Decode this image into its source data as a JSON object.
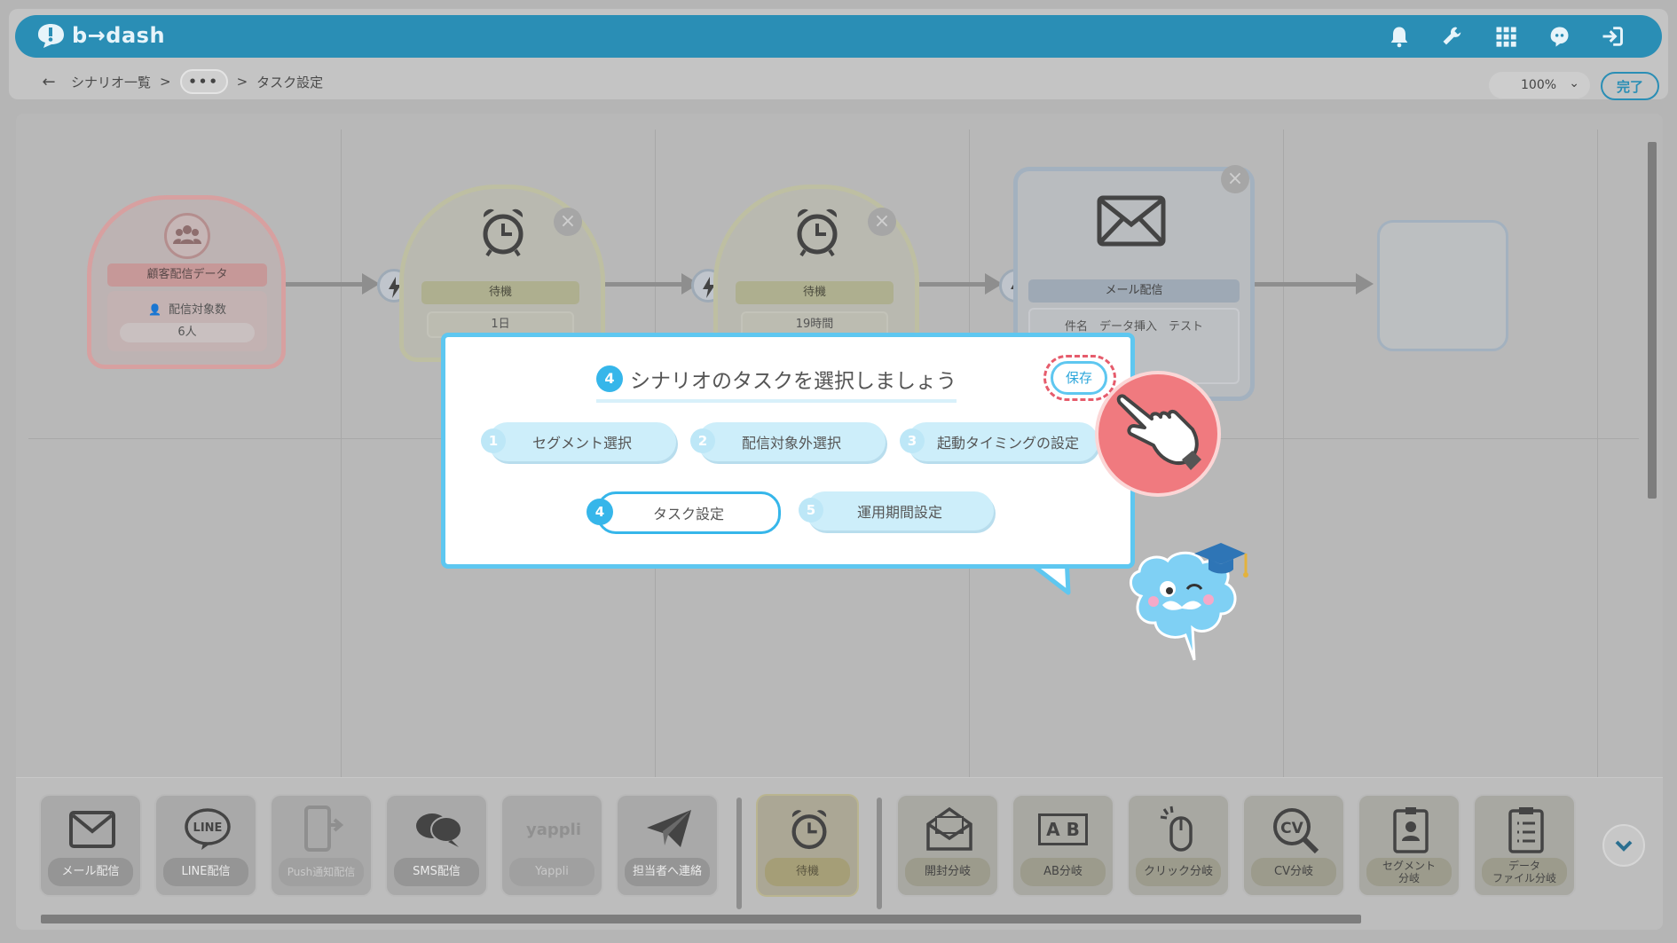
{
  "app": {
    "logo_text": "b→dash"
  },
  "topbar": {
    "icons": [
      "bell-icon",
      "wrench-icon",
      "grid-icon",
      "support-icon",
      "logout-icon"
    ]
  },
  "breadcrumb": {
    "back": "←",
    "root": "シナリオ一覧",
    "sep1": ">",
    "ellipsis": "•••",
    "sep2": ">",
    "current": "タスク設定"
  },
  "toolbar": {
    "zoom": "100%",
    "done_label": "完了"
  },
  "canvas": {
    "start_node": {
      "title": "顧客配信データ",
      "count_label": "配信対象数",
      "count_value": "6人"
    },
    "wait_nodes": [
      {
        "title": "待機",
        "value": "1日"
      },
      {
        "title": "待機",
        "value": "19時間"
      }
    ],
    "mail_node": {
      "title": "メール配信",
      "subject": "件名　データ挿入　テスト"
    }
  },
  "popup": {
    "step_number": "4",
    "title": "シナリオのタスクを選択しましょう",
    "save_label": "保存",
    "steps": [
      {
        "num": "1",
        "label": "セグメント選択"
      },
      {
        "num": "2",
        "label": "配信対象外選択"
      },
      {
        "num": "3",
        "label": "起動タイミングの設定"
      },
      {
        "num": "4",
        "label": "タスク設定"
      },
      {
        "num": "5",
        "label": "運用期間設定"
      }
    ]
  },
  "palette": {
    "items": [
      {
        "label": "メール配信",
        "icon": "mail-icon"
      },
      {
        "label": "LINE配信",
        "icon": "line-icon"
      },
      {
        "label": "Push通知配信",
        "icon": "push-icon"
      },
      {
        "label": "SMS配信",
        "icon": "sms-icon"
      },
      {
        "label": "Yappli",
        "icon_text": "yappli"
      },
      {
        "label": "担当者へ連絡",
        "icon": "paper-plane-icon"
      },
      {
        "label": "待機",
        "icon": "alarm-clock-icon"
      },
      {
        "label": "開封分岐",
        "icon": "open-mail-icon"
      },
      {
        "label": "AB分岐",
        "icon_text": "A B"
      },
      {
        "label": "クリック分岐",
        "icon": "mouse-click-icon"
      },
      {
        "label": "CV分岐",
        "icon_text": "CV"
      },
      {
        "label_line1": "セグメント",
        "label_line2": "分岐",
        "icon": "badge-icon"
      },
      {
        "label_line1": "データ",
        "label_line2": "ファイル分岐",
        "icon": "clipboard-icon"
      }
    ]
  },
  "colors": {
    "accent": "#36b6ea",
    "header": "#2a8eb5",
    "highlight": "#e65c6c"
  }
}
